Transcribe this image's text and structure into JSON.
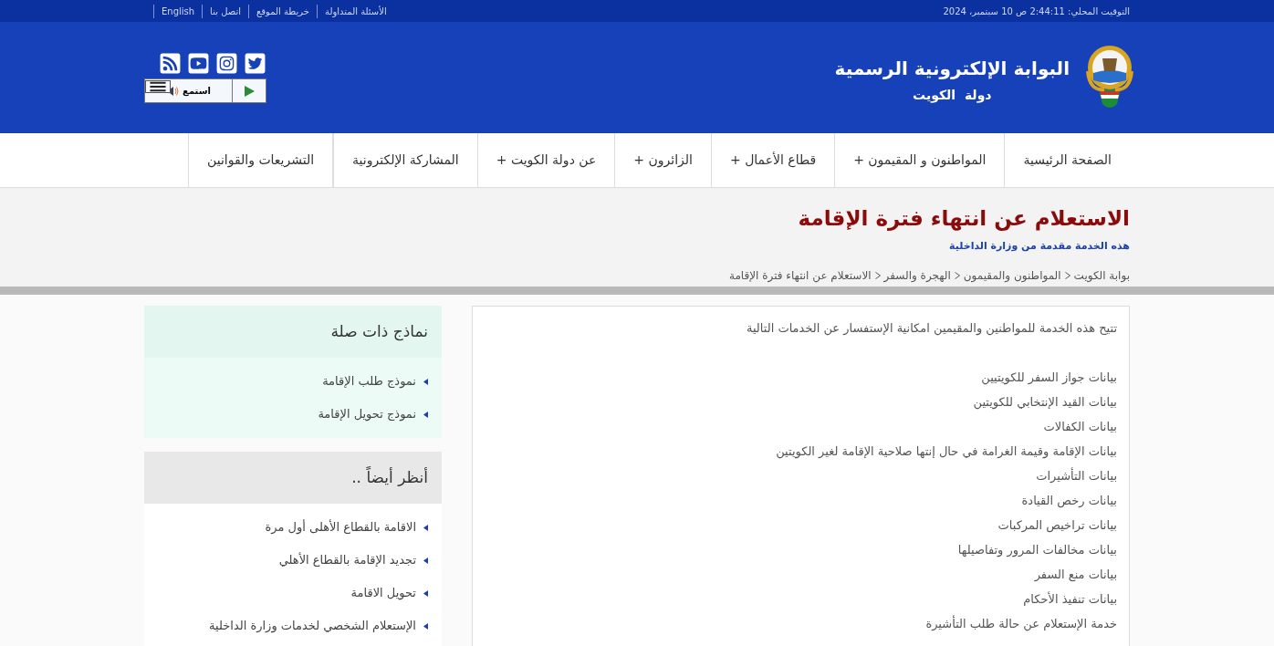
{
  "top_bar": {
    "links": [
      "الأسئلة المتداولة",
      "خريطة الموقع",
      "اتصل بنا",
      "English"
    ],
    "local_time": "التوقيت المحلي: 2:44:11 ص 10 سبتمبر، 2024"
  },
  "header": {
    "title": "البوابة الإلكترونية الرسمية",
    "subtitle": "دولة  الكويت",
    "listen_label": "استمع"
  },
  "nav": [
    "الصفحة الرئيسية",
    "المواطنون و المقيمون +",
    "قطاع الأعمال +",
    "الزائرون +",
    "عن دولة الكويت +",
    "المشاركة الإلكترونية",
    "التشريعات والقوانين"
  ],
  "page": {
    "title": "الاستعلام عن انتهاء فترة الإقامة",
    "provider": "هذه الخدمة مقدمة من وزارة الداخلية",
    "breadcrumb": [
      "بوابة الكويت",
      "المواطنون والمقيمون",
      "الهجرة والسفر",
      "الاستعلام عن انتهاء فترة الإقامة"
    ]
  },
  "content": {
    "intro": "تتيح هذه الخدمة للمواطنين والمقيمين امكانية الإستفسار عن الخدمات التالية",
    "services": [
      "بيانات جواز السفر للكويتيين",
      "بيانات القيد الإنتخابي للكويتين",
      "بيانات الكفالات",
      "بيانات الإقامة وقيمة الغرامة في حال إنتها صلاحية الإقامة لغير الكويتين",
      "بيانات التأشيرات",
      "بيانات رخص القيادة",
      "بيانات تراخيص المركبات",
      "بيانات مخالفات المرور وتفاصيلها",
      "بيانات منع السفر",
      "بيانات تنفيذ الأحكام",
      "خدمة الإستعلام عن حالة طلب التأشيرة"
    ]
  },
  "sidebar": [
    {
      "kind": "forms",
      "title": "نماذج ذات صلة",
      "links": [
        "نموذج طلب الإقامة",
        "نموذج تحويل الإقامة"
      ]
    },
    {
      "kind": "see_also",
      "title": "أنظر أيضاً ..",
      "links": [
        "الاقامة بالقطاع الأهلى أول مرة",
        "تجديد الإقامة بالقطاع الأهلي",
        "تحويل الاقامة",
        "الإستعلام الشخصي لخدمات وزارة الداخلية"
      ]
    }
  ]
}
